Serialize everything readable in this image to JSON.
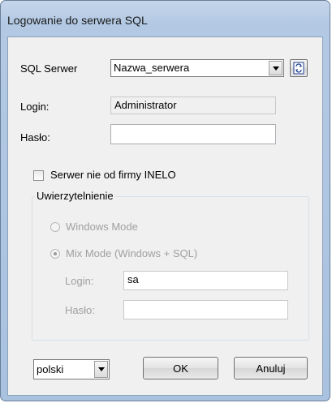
{
  "window": {
    "title": "Logowanie do serwera SQL"
  },
  "server": {
    "label": "SQL Serwer",
    "value": "Nazwa_serwera",
    "refresh_icon": "refresh-icon"
  },
  "login": {
    "label": "Login:",
    "value": "Administrator"
  },
  "password": {
    "label": "Hasło:",
    "value": ""
  },
  "non_inelo": {
    "label": "Serwer nie od firmy INELO",
    "checked": false
  },
  "auth": {
    "title": "Uwierzytelnienie",
    "windows_mode": "Windows Mode",
    "mix_mode": "Mix Mode (Windows + SQL)",
    "selected": "mix_mode",
    "login_label": "Login:",
    "login_value": "sa",
    "password_label": "Hasło:",
    "password_value": ""
  },
  "footer": {
    "language": "polski",
    "ok": "OK",
    "cancel": "Anuluj"
  }
}
